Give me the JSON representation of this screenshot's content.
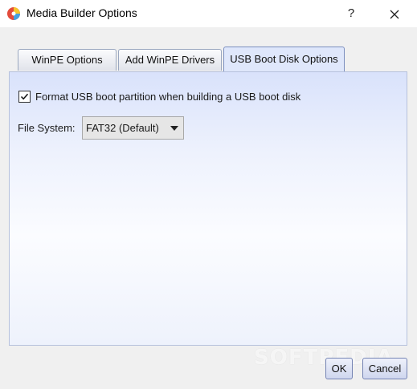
{
  "window": {
    "title": "Media Builder Options",
    "help_label": "?",
    "icon": "app-disk-icon",
    "close_icon": "close-icon"
  },
  "tabs": [
    {
      "label": "WinPE Options",
      "active": false
    },
    {
      "label": "Add WinPE Drivers",
      "active": false
    },
    {
      "label": "USB Boot Disk Options",
      "active": true
    }
  ],
  "usb_options": {
    "format_checkbox": {
      "label": "Format USB boot partition when building a USB boot disk",
      "checked": true
    },
    "file_system": {
      "label": "File System:",
      "value": "FAT32 (Default)"
    }
  },
  "buttons": {
    "ok": "OK",
    "cancel": "Cancel"
  },
  "watermark": "SOFTPEDIA",
  "colors": {
    "tab_active": "#dfe7fb",
    "panel_top": "#d9e2fb",
    "button_border": "#7584b4"
  }
}
